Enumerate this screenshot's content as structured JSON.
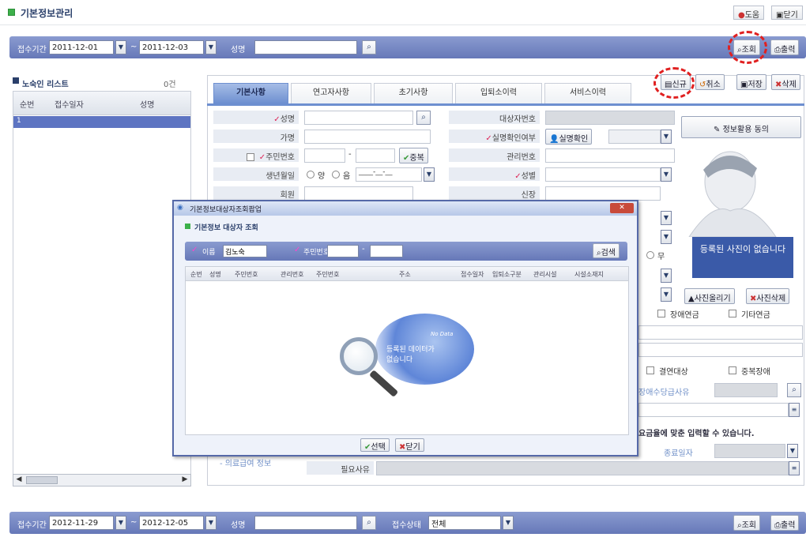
{
  "window": {
    "title": "기본정보관리",
    "help_label": "도움",
    "close_label": "닫기"
  },
  "top_search": {
    "period_label": "접수기간",
    "date_from": "2011-12-01",
    "date_to": "2011-12-03",
    "name_label": "성명",
    "name_value": "",
    "search_label": "조회",
    "print_label": "출력"
  },
  "list_panel": {
    "title": "노숙인 리스트",
    "count": "0건",
    "columns": [
      "순번",
      "접수일자",
      "성명"
    ],
    "rows": [
      {
        "no": "1"
      }
    ]
  },
  "action_buttons": {
    "new_label": "신규",
    "cancel_label": "취소",
    "save_label": "저장",
    "delete_label": "삭제"
  },
  "tabs": [
    "기본사항",
    "연고자사항",
    "초기사항",
    "입퇴소이력",
    "서비스이력"
  ],
  "form": {
    "name_label": "성명",
    "hanja_label": "가명",
    "rrn_label": "주민번호",
    "rrn_check_label": "중복",
    "birth_label": "생년월일",
    "solar_label": "양",
    "lunar_label": "음",
    "birth_value": "____-__-__",
    "religion_label": "회원",
    "target_no_label": "대상자번호",
    "real_name_check_label": "실명확인여부",
    "real_name_btn_label": "실명확인",
    "manage_no_label": "관리번호",
    "gender_label": "성별",
    "height_label": "신장",
    "info_consent_label": "정보활용 동의",
    "photo_note": "등록된 사진이 없습니다",
    "photo_upload_label": "사진올리기",
    "photo_delete_label": "사진삭제",
    "pension_disability_label": "장애연금",
    "pension_other_label": "기타연금",
    "exempt_label": "결연대상",
    "duplicate_disability_label": "중복장애",
    "allowance_label": "장애수당급사유",
    "notice_text": "요금율에 맞춘 입력할 수 있습니다.",
    "end_date_label": "종료일자",
    "bottom_left_label": "- 의료급여 정보",
    "reason_label": "필요사유",
    "side_check_label": "무"
  },
  "popup": {
    "title": "기본정보대상자조회팝업",
    "section_title": "기본정보 대상자 조회",
    "name_label": "이름",
    "name_value": "김노숙",
    "rrn_label": "주민번호",
    "search_label": "검색",
    "columns": [
      "순번",
      "성명",
      "주민번호",
      "관리번호",
      "주민번호",
      "주소",
      "접수일자",
      "입퇴소구분",
      "관리시설",
      "시설소재지"
    ],
    "no_data_en": "No Data",
    "no_data_text_1": "등록된 데이터가",
    "no_data_text_2": "없습니다",
    "select_label": "선택",
    "close_label": "닫기"
  },
  "bottom_search": {
    "period_label": "접수기간",
    "date_from": "2012-11-29",
    "date_to": "2012-12-05",
    "name_label": "성명",
    "status_label": "접수상태",
    "status_value": "전체",
    "search_label": "조회",
    "print_label": "출력"
  }
}
